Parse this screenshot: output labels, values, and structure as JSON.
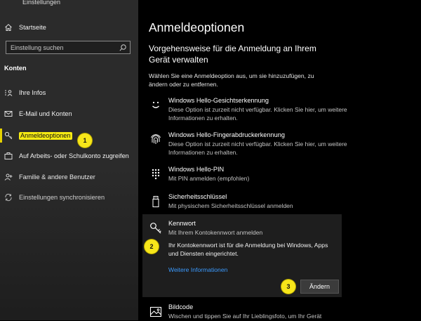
{
  "sidebar": {
    "app_title": "Einstellungen",
    "home_label": "Startseite",
    "search_placeholder": "Einstellung suchen",
    "section_title": "Konten",
    "items": [
      {
        "label": "Ihre Infos",
        "icon": "person-list-icon"
      },
      {
        "label": "E-Mail und Konten",
        "icon": "mail-icon"
      },
      {
        "label": "Anmeldeoptionen",
        "icon": "key-icon",
        "selected": true
      },
      {
        "label": "Auf Arbeits- oder Schulkonto zugreifen",
        "icon": "briefcase-icon"
      },
      {
        "label": "Familie & andere Benutzer",
        "icon": "people-add-icon"
      },
      {
        "label": "Einstellungen synchronisieren",
        "icon": "sync-icon"
      }
    ]
  },
  "annotations": [
    "1",
    "2",
    "3"
  ],
  "main": {
    "title": "Anmeldeoptionen",
    "subtitle": "Vorgehensweise für die Anmeldung an Ihrem Gerät verwalten",
    "intro": "Wählen Sie eine Anmeldeoption aus, um sie hinzuzufügen, zu ändern oder zu entfernen.",
    "options": [
      {
        "title": "Windows Hello-Gesichtserkennung",
        "desc": "Diese Option ist zurzeit nicht verfügbar. Klicken Sie hier, um weitere Informationen zu erhalten.",
        "icon": "smiley-face-icon"
      },
      {
        "title": "Windows Hello-Fingerabdruckerkennung",
        "desc": "Diese Option ist zurzeit nicht verfügbar. Klicken Sie hier, um weitere Informationen zu erhalten.",
        "icon": "fingerprint-icon"
      },
      {
        "title": "Windows Hello-PIN",
        "desc": "Mit PIN anmelden (empfohlen)",
        "icon": "pin-keypad-icon"
      },
      {
        "title": "Sicherheitsschlüssel",
        "desc": "Mit physischem Sicherheitsschlüssel anmelden",
        "icon": "usb-key-icon"
      },
      {
        "title": "Kennwort",
        "desc": "Mit Ihrem Kontokennwort anmelden",
        "icon": "key-icon"
      },
      {
        "title": "Bildcode",
        "desc": "Wischen und tippen Sie auf Ihr Lieblingsfoto, um Ihr Gerät",
        "icon": "picture-icon"
      }
    ],
    "password_panel": {
      "info": "Ihr Kontokennwort ist für die Anmeldung bei Windows, Apps und Diensten eingerichtet.",
      "link": "Weitere Informationen",
      "button": "Ändern"
    }
  },
  "colors": {
    "highlight": "#f5ea13",
    "link": "#3b9bff",
    "sidebar_bg": "#2b2b2b",
    "panel_bg": "#1e1e1e"
  }
}
